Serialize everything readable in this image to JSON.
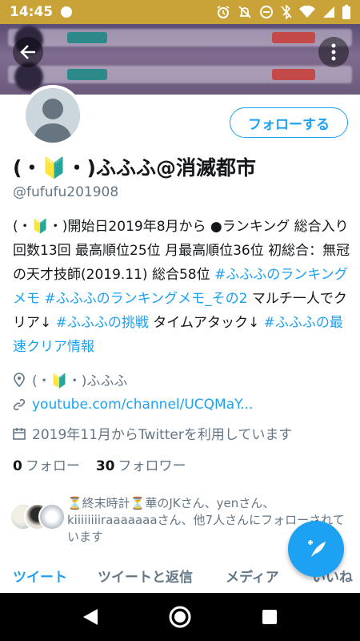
{
  "status_bar": {
    "time": "14:45",
    "icons": [
      "notification-dot-icon",
      "alarm-icon",
      "notifications-off-icon",
      "do-not-disturb-icon",
      "bluetooth-off-icon",
      "wifi-icon",
      "signal-icon",
      "battery-icon"
    ]
  },
  "header": {
    "back_icon": "arrow-left-icon",
    "more_icon": "more-vertical-icon"
  },
  "profile": {
    "follow_label": "フォローする",
    "display_name": "(・🔰・)ふふふ@消滅都市",
    "handle": "@fufufu201908",
    "bio": [
      {
        "text": "(・🔰・)開始日2019年8月から ●ランキング 総合入り回数13回 最高順位25位 月最高順位36位 初総合：無冠の天才技師(2019.11) 総合58位 ",
        "link": false
      },
      {
        "text": "#ふふふのランキングメモ",
        "link": true
      },
      {
        "text": " ",
        "link": false
      },
      {
        "text": "#ふふふのランキングメモ_その2",
        "link": true
      },
      {
        "text": " マルチ一人でクリア↓ ",
        "link": false
      },
      {
        "text": "#ふふふの挑戦",
        "link": true
      },
      {
        "text": " タイムアタック↓ ",
        "link": false
      },
      {
        "text": "#ふふふの最速クリア情報",
        "link": true
      }
    ],
    "location": "(・🔰・)ふふふ",
    "website": "youtube.com/channel/UCQMaY...",
    "joined": "2019年11月からTwitterを利用しています",
    "following_count": "0",
    "following_label": "フォロー",
    "followers_count": "30",
    "followers_label": "フォロワー",
    "followed_by": "⏳終末時計⏳華のJKさん、yenさん、kiiiiiiiiraaaaaaaさん、他7人さんにフォローされています"
  },
  "tabs": [
    {
      "label": "ツイート",
      "active": true
    },
    {
      "label": "ツイートと返信",
      "active": false
    },
    {
      "label": "メディア",
      "active": false
    },
    {
      "label": "いいね",
      "active": false
    }
  ],
  "fab": {
    "icon": "compose-tweet-icon"
  },
  "nav_bar": {
    "icons": [
      "nav-back-icon",
      "nav-home-icon",
      "nav-recents-icon"
    ]
  },
  "colors": {
    "accent": "#1da1f2",
    "status_bar": "#c9a238",
    "secondary_text": "#657786",
    "primary_text": "#14171a"
  }
}
